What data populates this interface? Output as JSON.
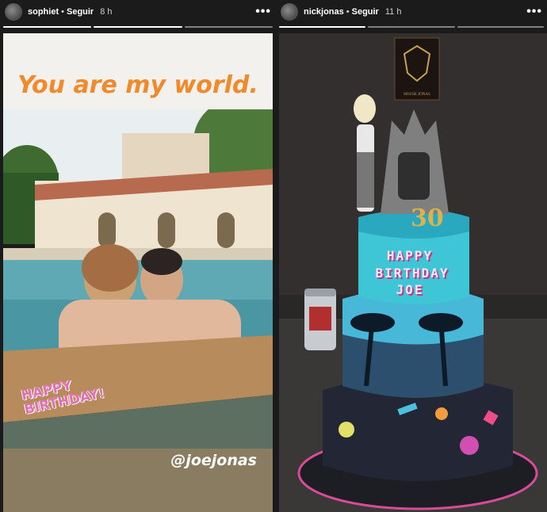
{
  "stories": [
    {
      "username": "sophiet",
      "follow_label": "Seguir",
      "time": "8 h",
      "headline": "You are my world.",
      "mention": "@joejonas",
      "sticker": [
        "HAPPY",
        "BIRTHDAY!"
      ],
      "progress": {
        "total": 3,
        "completed": 2
      }
    },
    {
      "username": "nickjonas",
      "follow_label": "Seguir",
      "time": "11 h",
      "cake_text": [
        "HAPPY",
        "BIRTHDAY",
        "JOE"
      ],
      "topper_number": "30",
      "sign_text": "HOUSE JONAS",
      "progress": {
        "total": 3,
        "completed": 1
      }
    }
  ],
  "separator": "•",
  "more_glyph": "•••",
  "colors": {
    "headline": "#f08a2a",
    "cake_teal": "#3ec6d6",
    "sticker_pink": "#e36eb1"
  }
}
